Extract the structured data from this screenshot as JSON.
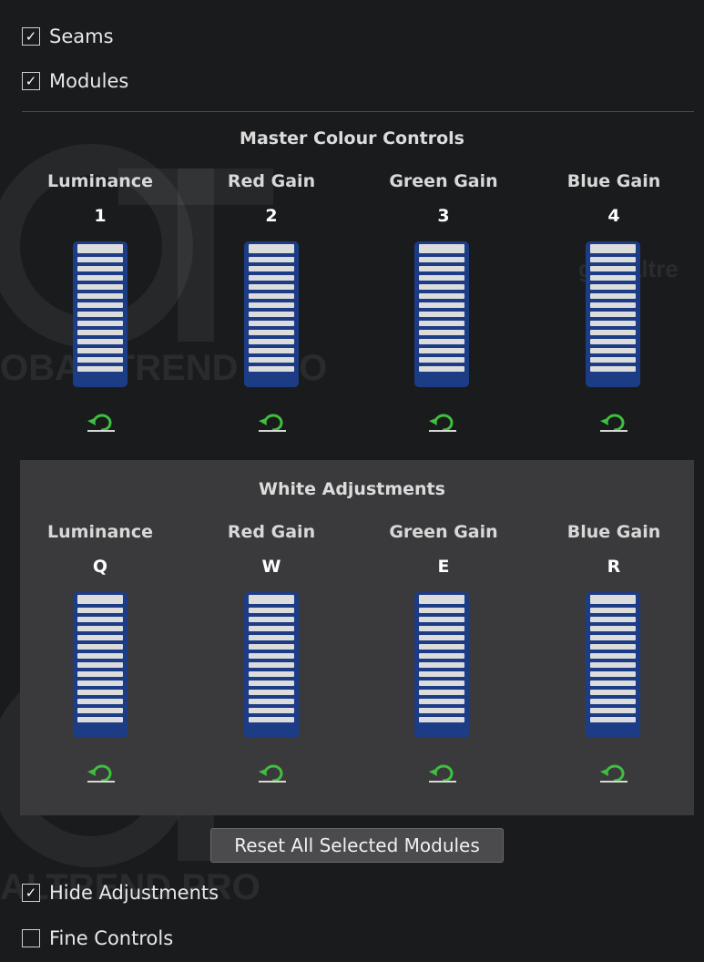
{
  "checkboxes_top": [
    {
      "label": "Seams",
      "checked": true
    },
    {
      "label": "Modules",
      "checked": true
    }
  ],
  "check_mark": "✓",
  "master": {
    "title": "Master Colour Controls",
    "channels": [
      {
        "label": "Luminance",
        "key": "1"
      },
      {
        "label": "Red Gain",
        "key": "2"
      },
      {
        "label": "Green Gain",
        "key": "3"
      },
      {
        "label": "Blue Gain",
        "key": "4"
      }
    ]
  },
  "white": {
    "title": "White Adjustments",
    "channels": [
      {
        "label": "Luminance",
        "key": "Q"
      },
      {
        "label": "Red Gain",
        "key": "W"
      },
      {
        "label": "Green Gain",
        "key": "E"
      },
      {
        "label": "Blue Gain",
        "key": "R"
      }
    ]
  },
  "reset_button": "Reset All Selected Modules",
  "checkboxes_bottom": [
    {
      "label": "Hide Adjustments",
      "checked": true
    },
    {
      "label": "Fine Controls",
      "checked": false
    }
  ],
  "watermark": {
    "text_a": "OBAL TREND PRO",
    "text_b": "globaltrend.oncestaging.com",
    "text_c": "globaltre",
    "text_d": "ALTREND PRO"
  },
  "colors": {
    "background": "#1a1b1d",
    "panel": "#3a3a3c",
    "slider_blue": "#1d3c86",
    "reset_green": "#3fbf3f"
  },
  "icons": {
    "reset": "reset-arrow-icon",
    "check": "checkmark-icon"
  }
}
